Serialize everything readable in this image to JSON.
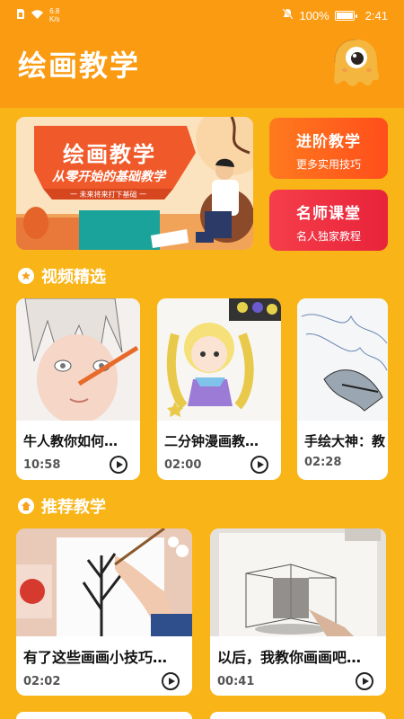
{
  "status": {
    "net_speed_value": "6.8",
    "net_speed_unit": "K/s",
    "battery": "100%",
    "time": "2:41"
  },
  "header": {
    "title": "绘画教学"
  },
  "banner": {
    "title": "绘画教学",
    "subtitle": "从零开始的基础教学",
    "note": "一 未来将来打下基础 一"
  },
  "side_cards": [
    {
      "title": "进阶教学",
      "subtitle": "更多实用技巧"
    },
    {
      "title": "名师课堂",
      "subtitle": "名人独家教程"
    }
  ],
  "sections": {
    "videos": "视频精选",
    "recommended": "推荐教学"
  },
  "videos": [
    {
      "title": "牛人教你如何…",
      "duration": "10:58"
    },
    {
      "title": "二分钟漫画教…",
      "duration": "02:00"
    },
    {
      "title": "手绘大神：教",
      "duration": "02:28"
    }
  ],
  "recommended": [
    {
      "title": "有了这些画画小技巧…",
      "duration": "02:02"
    },
    {
      "title": "以后，我教你画画吧…",
      "duration": "00:41"
    }
  ],
  "colors": {
    "background": "#F9B417",
    "header": "#FB9B12",
    "advanced_card": "#FF5E1C",
    "master_card": "#EE2E42"
  }
}
